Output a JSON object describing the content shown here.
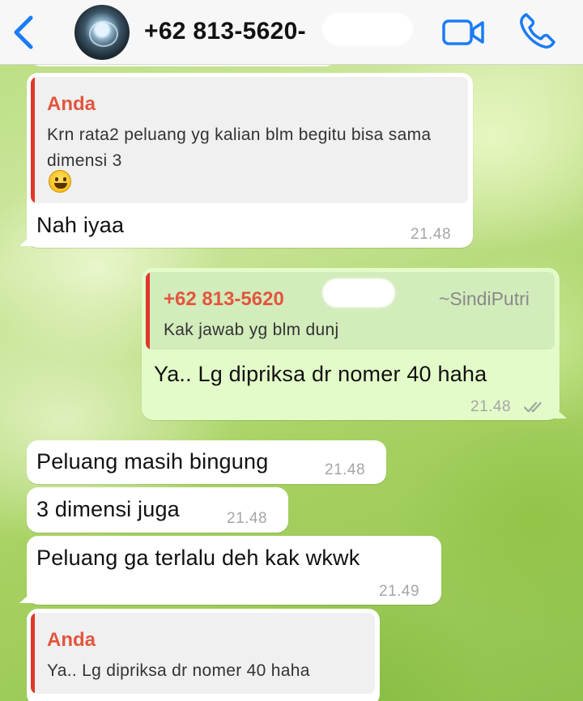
{
  "header": {
    "contact_name": "+62 813-5620-",
    "back_icon": "chevron-left-icon",
    "video_icon": "video-camera-icon",
    "call_icon": "phone-icon",
    "accent_color": "#1a7cf5"
  },
  "messages": [
    {
      "direction": "in",
      "quote": {
        "author": "Anda",
        "text": "Krn rata2 peluang yg kalian blm begitu bisa sama dimensi 3",
        "emoji": "grinning-face-emoji"
      },
      "text": "Nah iyaa",
      "time": "21.48"
    },
    {
      "direction": "out",
      "quote": {
        "author": "+62 813-5620",
        "push_name": "~SindiPutri",
        "text": "Kak jawab yg blm dunj"
      },
      "text": "Ya.. Lg dipriksa dr nomer 40 haha",
      "time": "21.48",
      "status_icon": "double-check-icon"
    },
    {
      "direction": "in",
      "text": "Peluang masih bingung",
      "time": "21.48"
    },
    {
      "direction": "in",
      "text": "3 dimensi juga",
      "time": "21.48"
    },
    {
      "direction": "in",
      "text": "Peluang ga terlalu deh kak wkwk",
      "time": "21.49"
    },
    {
      "direction": "in",
      "quote": {
        "author": "Anda",
        "text": "Ya.. Lg dipriksa dr nomer 40 haha"
      }
    }
  ]
}
